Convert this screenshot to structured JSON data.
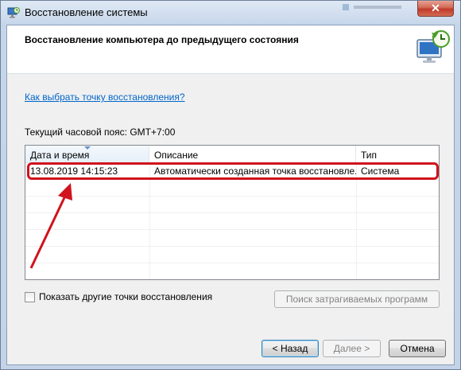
{
  "window": {
    "title": "Восстановление системы",
    "close_glyph": "✕"
  },
  "header": {
    "title": "Восстановление компьютера до предыдущего состояния",
    "icon": "system-restore-icon"
  },
  "link_text": "Как выбрать точку восстановления?",
  "timezone_text": "Текущий часовой пояс: GMT+7:00",
  "table": {
    "columns": [
      "Дата и время",
      "Описание",
      "Тип"
    ],
    "rows": [
      [
        "13.08.2019 14:15:23",
        "Автоматически созданная точка восстановле...",
        "Система"
      ]
    ]
  },
  "show_more": {
    "label": "Показать другие точки восстановления",
    "checked": false
  },
  "buttons": {
    "programs": "Поиск затрагиваемых программ",
    "back": "< Назад",
    "next": "Далее >",
    "cancel": "Отмена"
  },
  "colors": {
    "highlight": "#d0131c",
    "link": "#0066cc",
    "close_button": "#c0392b"
  }
}
